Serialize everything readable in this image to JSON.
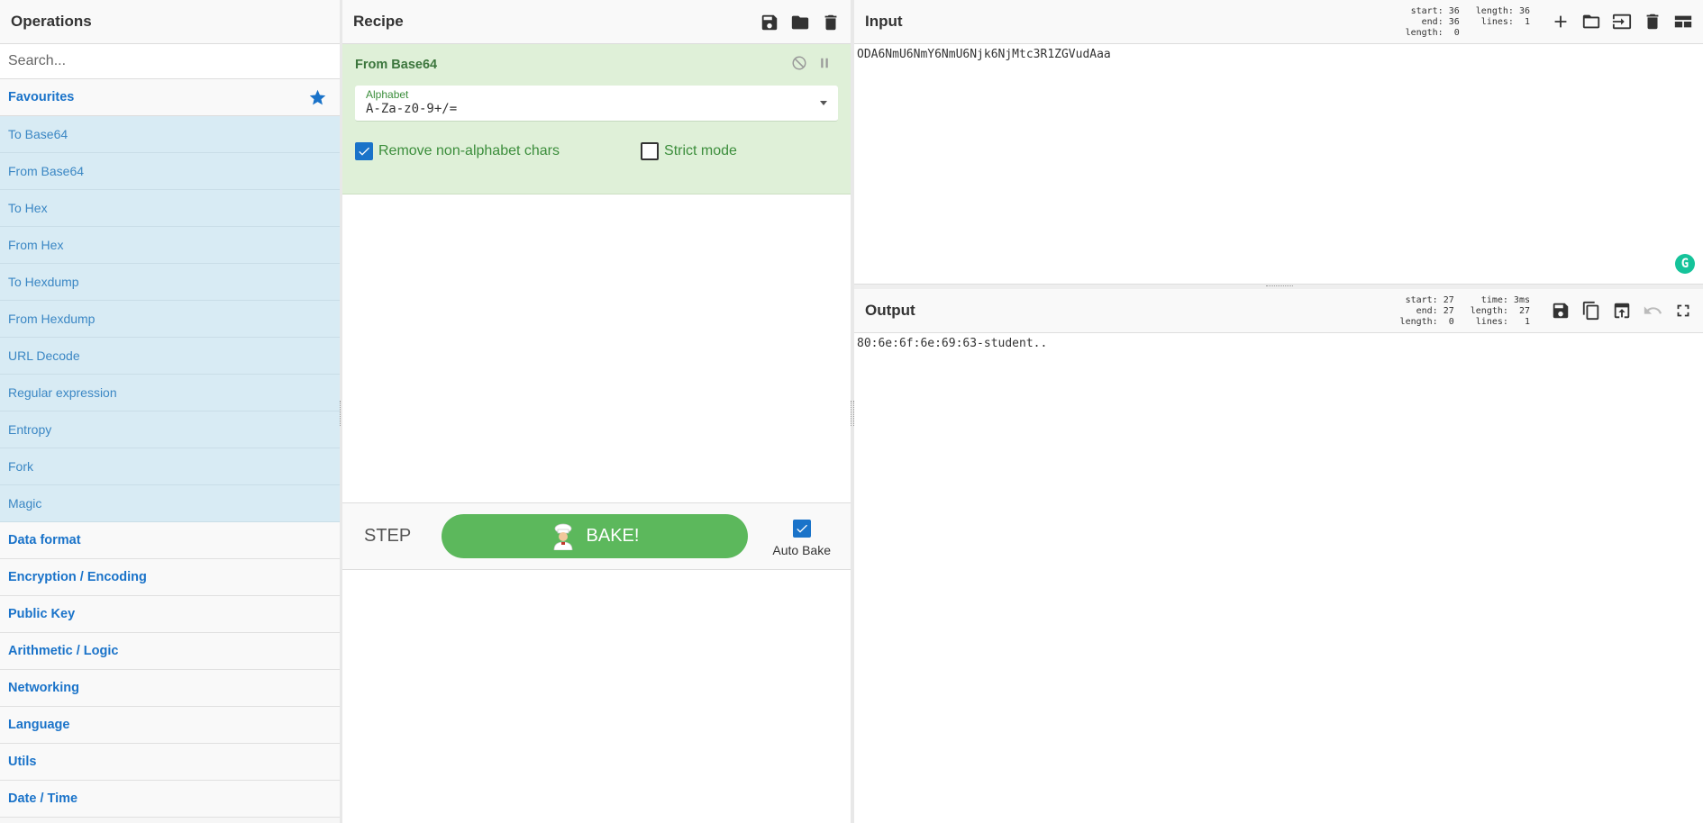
{
  "operations": {
    "title": "Operations",
    "search_placeholder": "Search...",
    "favourites_label": "Favourites",
    "favourites": [
      "To Base64",
      "From Base64",
      "To Hex",
      "From Hex",
      "To Hexdump",
      "From Hexdump",
      "URL Decode",
      "Regular expression",
      "Entropy",
      "Fork",
      "Magic"
    ],
    "categories": [
      "Data format",
      "Encryption / Encoding",
      "Public Key",
      "Arithmetic / Logic",
      "Networking",
      "Language",
      "Utils",
      "Date / Time"
    ]
  },
  "recipe": {
    "title": "Recipe",
    "op": {
      "name": "From Base64",
      "arg_label": "Alphabet",
      "arg_value": "A-Za-z0-9+/=",
      "check1_label": "Remove non-alphabet chars",
      "check1_checked": true,
      "check2_label": "Strict mode",
      "check2_checked": false
    },
    "step_label": "STEP",
    "bake_label": "BAKE!",
    "auto_bake_label": "Auto Bake",
    "auto_bake_checked": true
  },
  "input": {
    "title": "Input",
    "stats_left": "start: 36\n  end: 36\nlength:  0",
    "stats_right": "length: 36\n lines:  1",
    "text": "ODA6NmU6NmY6NmU6Njk6NjMtc3R1ZGVudAaa"
  },
  "output": {
    "title": "Output",
    "stats_left": "start: 27\n  end: 27\nlength:  0",
    "stats_right": "  time: 3ms\nlength:  27\n lines:   1",
    "text": "80:6e:6f:6e:69:63-student.."
  },
  "colors": {
    "accent": "#1a73c9",
    "favourite_bg": "#d8ebf4",
    "recipe_op_bg": "#dff0d8",
    "bake_green": "#5cb85c"
  }
}
